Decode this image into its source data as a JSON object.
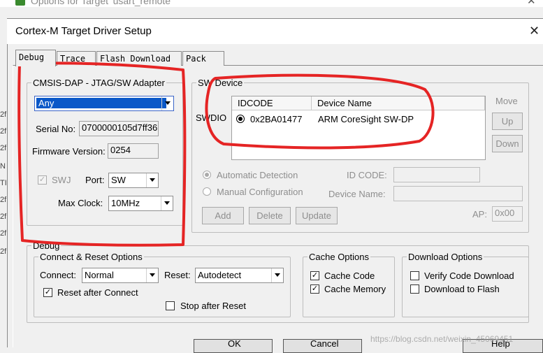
{
  "parent_window": {
    "title": "Options for Target 'usart_remote'",
    "close_glyph": "✕"
  },
  "left_edge_chars": [
    "2f",
    "2f",
    "2f",
    "N",
    "TI",
    "2f",
    "2f",
    "2f",
    "2f"
  ],
  "dialog": {
    "title": "Cortex-M Target Driver Setup",
    "close_glyph": "✕"
  },
  "tabs": [
    "Debug",
    "Trace",
    "Flash Download",
    "Pack"
  ],
  "adapter": {
    "legend": "CMSIS-DAP - JTAG/SW Adapter",
    "selected": "Any",
    "serial_label": "Serial No:",
    "serial_value": "0700000105d7ff36",
    "firmware_label": "Firmware Version:",
    "firmware_value": "0254",
    "swj_label": "SWJ",
    "port_label": "Port:",
    "port_value": "SW",
    "clock_label": "Max Clock:",
    "clock_value": "10MHz"
  },
  "sw_device": {
    "legend": "SW Device",
    "swdio_label": "SWDIO",
    "columns": [
      "IDCODE",
      "Device Name"
    ],
    "rows": [
      {
        "idcode": "0x2BA01477",
        "device": "ARM CoreSight SW-DP"
      }
    ],
    "move_label": "Move",
    "up_label": "Up",
    "down_label": "Down",
    "auto_label": "Automatic Detection",
    "manual_label": "Manual Configuration",
    "idcode_label": "ID CODE:",
    "devname_label": "Device Name:",
    "add_label": "Add",
    "delete_label": "Delete",
    "update_label": "Update",
    "ap_label": "AP:",
    "ap_value": "0x00"
  },
  "debug": {
    "legend": "Debug",
    "connect_reset_legend": "Connect & Reset Options",
    "connect_label": "Connect:",
    "connect_value": "Normal",
    "reset_label": "Reset:",
    "reset_value": "Autodetect",
    "reset_after_connect": "Reset after Connect",
    "stop_after_reset": "Stop after Reset",
    "cache_legend": "Cache Options",
    "cache_code": "Cache Code",
    "cache_memory": "Cache Memory",
    "download_legend": "Download Options",
    "verify_download": "Verify Code Download",
    "download_flash": "Download to Flash"
  },
  "bottom_buttons": [
    "OK",
    "Cancel",
    "Help"
  ],
  "watermark": "https://blog.csdn.net/weixin_45069451",
  "check_glyph": "✓",
  "colors": {
    "annotation_red": "#e52424",
    "disabled_text": "#8e8e8e"
  }
}
